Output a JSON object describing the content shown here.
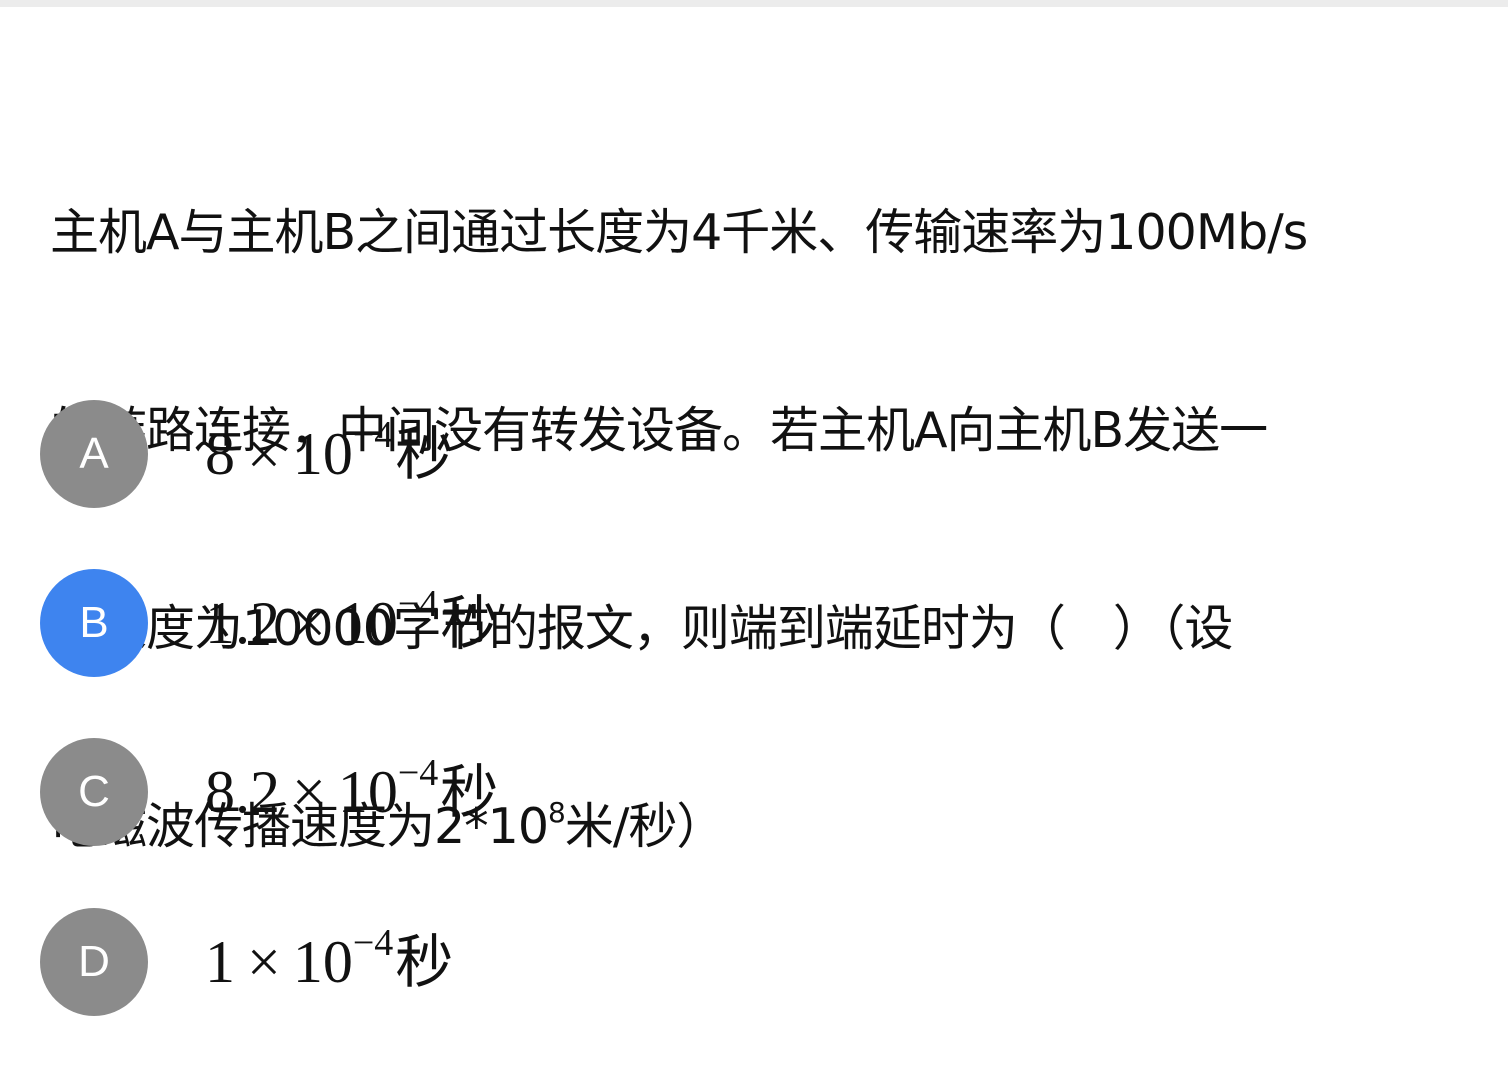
{
  "question": {
    "line1": "主机A与主机B之间通过长度为4千米、传输速率为100Mb/s",
    "line2": "的链路连接，中间没有转发设备。若主机A向主机B发送一",
    "line3": "个长度为10000字节的报文，则端到端延时为（　）（设",
    "line4_before": "电磁波传播速度为2*10",
    "line4_exp": "8",
    "line4_after": "米/秒）"
  },
  "options": [
    {
      "letter": "A",
      "mantissa": "8",
      "times": "×",
      "base": "10",
      "exponent": "−4",
      "unit": "秒",
      "selected": false
    },
    {
      "letter": "B",
      "mantissa": "1.2",
      "times": "×",
      "base": "10",
      "exponent": "−4",
      "unit": "秒",
      "selected": true
    },
    {
      "letter": "C",
      "mantissa": "8.2",
      "times": "×",
      "base": "10",
      "exponent": "−4",
      "unit": "秒",
      "selected": false
    },
    {
      "letter": "D",
      "mantissa": "1",
      "times": "×",
      "base": "10",
      "exponent": "−4",
      "unit": "秒",
      "selected": false
    }
  ],
  "colors": {
    "selected_badge": "#3e84ef",
    "unselected_badge": "#8b8b8b",
    "text": "#111111"
  }
}
